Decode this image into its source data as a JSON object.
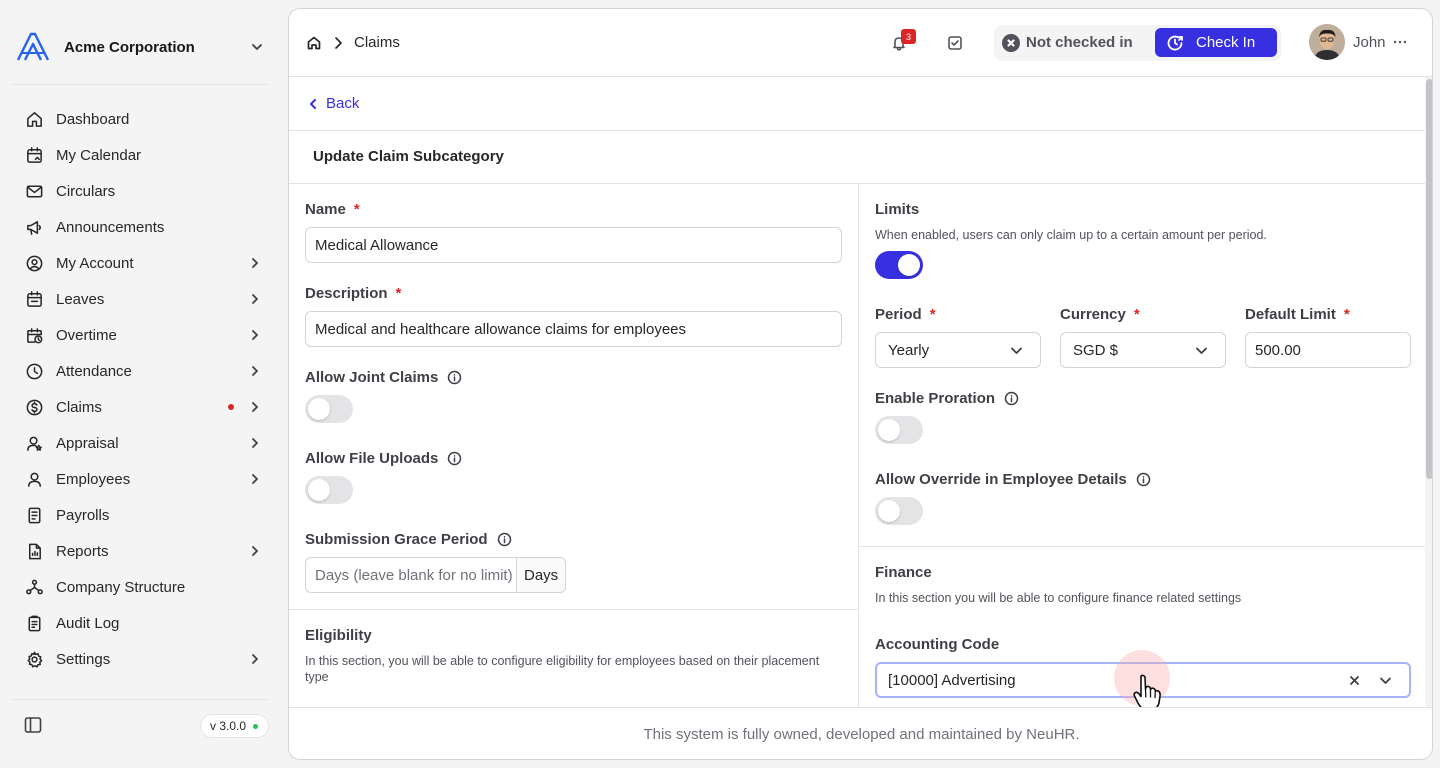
{
  "org": {
    "name": "Acme Corporation"
  },
  "sidebar": {
    "items": [
      {
        "label": "Dashboard",
        "icon": "home-icon",
        "chevron": false
      },
      {
        "label": "My Calendar",
        "icon": "calendar-icon",
        "chevron": false
      },
      {
        "label": "Circulars",
        "icon": "mail-icon",
        "chevron": false
      },
      {
        "label": "Announcements",
        "icon": "megaphone-icon",
        "chevron": false
      },
      {
        "label": "My Account",
        "icon": "user-circle-icon",
        "chevron": true
      },
      {
        "label": "Leaves",
        "icon": "calendar-check-icon",
        "chevron": true
      },
      {
        "label": "Overtime",
        "icon": "calendar-clock-icon",
        "chevron": true
      },
      {
        "label": "Attendance",
        "icon": "clock-icon",
        "chevron": true
      },
      {
        "label": "Claims",
        "icon": "dollar-circle-icon",
        "chevron": true,
        "dot": true
      },
      {
        "label": "Appraisal",
        "icon": "user-star-icon",
        "chevron": true
      },
      {
        "label": "Employees",
        "icon": "user-icon",
        "chevron": true
      },
      {
        "label": "Payrolls",
        "icon": "receipt-icon",
        "chevron": false
      },
      {
        "label": "Reports",
        "icon": "file-chart-icon",
        "chevron": true
      },
      {
        "label": "Company Structure",
        "icon": "network-icon",
        "chevron": false
      },
      {
        "label": "Audit Log",
        "icon": "clipboard-icon",
        "chevron": false
      },
      {
        "label": "Settings",
        "icon": "gear-icon",
        "chevron": true
      }
    ],
    "version": "v 3.0.0"
  },
  "topbar": {
    "breadcrumb": "Claims",
    "notification_count": "3",
    "checkin_status": "Not checked in",
    "checkin_button": "Check In",
    "user_name": "John"
  },
  "page": {
    "back": "Back",
    "title": "Update Claim Subcategory",
    "footer": "This system is fully owned, developed and maintained by NeuHR."
  },
  "form": {
    "name": {
      "label": "Name",
      "required": "*",
      "value": "Medical Allowance"
    },
    "description": {
      "label": "Description",
      "required": "*",
      "value": "Medical and healthcare allowance claims for employees"
    },
    "allow_joint_claims": {
      "label": "Allow Joint Claims",
      "on": false
    },
    "allow_file_uploads": {
      "label": "Allow File Uploads",
      "on": false
    },
    "grace_period": {
      "label": "Submission Grace Period",
      "placeholder": "Days (leave blank for no limit)",
      "addon": "Days"
    },
    "eligibility": {
      "title": "Eligibility",
      "subtitle": "In this section, you will be able to configure eligibility for employees based on their placement type"
    },
    "limits": {
      "title": "Limits",
      "subtitle": "When enabled, users can only claim up to a certain amount per period.",
      "on": true
    },
    "period": {
      "label": "Period",
      "required": "*",
      "value": "Yearly"
    },
    "currency": {
      "label": "Currency",
      "required": "*",
      "value": "SGD $"
    },
    "default_limit": {
      "label": "Default Limit",
      "required": "*",
      "value": "500.00"
    },
    "enable_proration": {
      "label": "Enable Proration",
      "on": false
    },
    "allow_override": {
      "label": "Allow Override in Employee Details",
      "on": false
    },
    "finance": {
      "title": "Finance",
      "subtitle": "In this section you will be able to configure finance related settings"
    },
    "accounting_code": {
      "label": "Accounting Code",
      "value": "[10000] Advertising"
    }
  },
  "colors": {
    "accent": "#3730e0",
    "required": "#dc2626",
    "badge": "#dc2626",
    "online": "#22c55e"
  }
}
